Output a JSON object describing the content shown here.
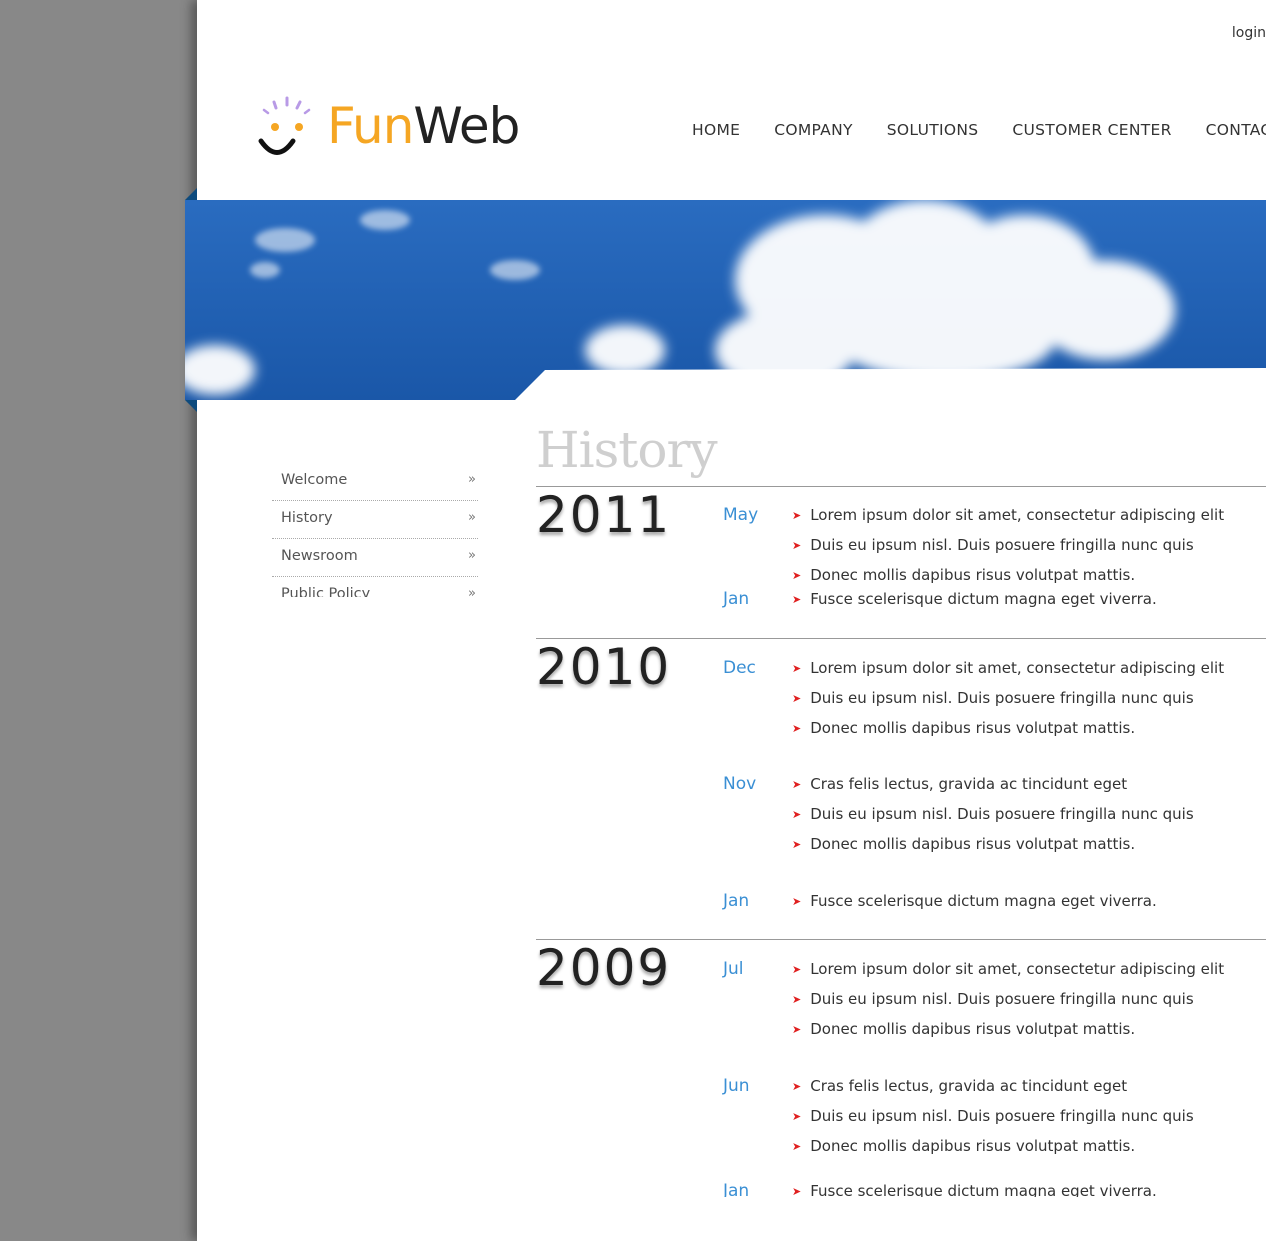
{
  "header": {
    "login": "login",
    "logo": {
      "fun": "Fun",
      "web": "Web"
    },
    "nav": [
      "HOME",
      "COMPANY",
      "SOLUTIONS",
      "CUSTOMER CENTER",
      "CONTACT"
    ]
  },
  "sidebar": {
    "items": [
      {
        "label": "Welcome"
      },
      {
        "label": "History"
      },
      {
        "label": "Newsroom"
      },
      {
        "label": "Public Policy"
      }
    ]
  },
  "content": {
    "title": "History",
    "years": [
      {
        "year": "2011",
        "entries": [
          {
            "month": "May",
            "items": [
              "Lorem ipsum dolor sit amet, consectetur adipiscing elit",
              "Duis eu ipsum nisl. Duis posuere fringilla nunc quis",
              "Donec mollis dapibus risus volutpat mattis."
            ]
          },
          {
            "month": "Jan",
            "items": [
              "Fusce scelerisque dictum magna eget viverra."
            ]
          }
        ]
      },
      {
        "year": "2010",
        "entries": [
          {
            "month": "Dec",
            "items": [
              "Lorem ipsum dolor sit amet, consectetur adipiscing elit",
              "Duis eu ipsum nisl. Duis posuere fringilla nunc quis",
              "Donec mollis dapibus risus volutpat mattis."
            ]
          },
          {
            "month": "Nov",
            "items": [
              "Cras felis lectus, gravida ac tincidunt eget",
              "Duis eu ipsum nisl. Duis posuere fringilla nunc quis",
              "Donec mollis dapibus risus volutpat mattis."
            ]
          },
          {
            "month": "Jan",
            "items": [
              "Fusce scelerisque dictum magna eget viverra."
            ]
          }
        ]
      },
      {
        "year": "2009",
        "entries": [
          {
            "month": "Jul",
            "items": [
              "Lorem ipsum dolor sit amet, consectetur adipiscing elit",
              "Duis eu ipsum nisl. Duis posuere fringilla nunc quis",
              "Donec mollis dapibus risus volutpat mattis."
            ]
          },
          {
            "month": "Jun",
            "items": [
              "Cras felis lectus, gravida ac tincidunt eget",
              "Duis eu ipsum nisl. Duis posuere fringilla nunc quis",
              "Donec mollis dapibus risus volutpat mattis."
            ]
          },
          {
            "month": "Jan",
            "items": [
              "Fusce scelerisque dictum magna eget viverra."
            ]
          }
        ]
      }
    ]
  },
  "colors": {
    "accent": "#3a8fd4",
    "logo_orange": "#f5a623",
    "bullet": "#e02020",
    "sky": "#1f5fb0"
  }
}
